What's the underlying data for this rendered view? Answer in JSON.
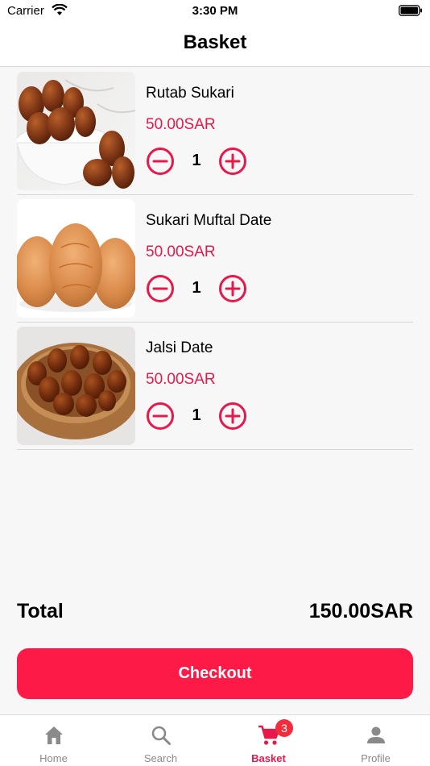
{
  "status_bar": {
    "carrier": "Carrier",
    "time": "3:30 PM"
  },
  "header": {
    "title": "Basket"
  },
  "basket": {
    "items": [
      {
        "name": "Rutab Sukari",
        "price": "50.00SAR",
        "quantity": "1"
      },
      {
        "name": "Sukari Muftal Date",
        "price": "50.00SAR",
        "quantity": "1"
      },
      {
        "name": "Jalsi Date",
        "price": "50.00SAR",
        "quantity": "1"
      }
    ]
  },
  "summary": {
    "total_label": "Total",
    "total_value": "150.00SAR"
  },
  "checkout": {
    "label": "Checkout"
  },
  "tab_bar": {
    "tabs": [
      {
        "label": "Home",
        "icon": "home-icon"
      },
      {
        "label": "Search",
        "icon": "search-icon"
      },
      {
        "label": "Basket",
        "icon": "cart-icon",
        "badge": "3"
      },
      {
        "label": "Profile",
        "icon": "profile-icon"
      }
    ],
    "active": "Basket"
  },
  "colors": {
    "accent": "#e8184a",
    "button": "#fe1a47",
    "badge": "#f22c3c",
    "background": "#f7f7f7"
  }
}
